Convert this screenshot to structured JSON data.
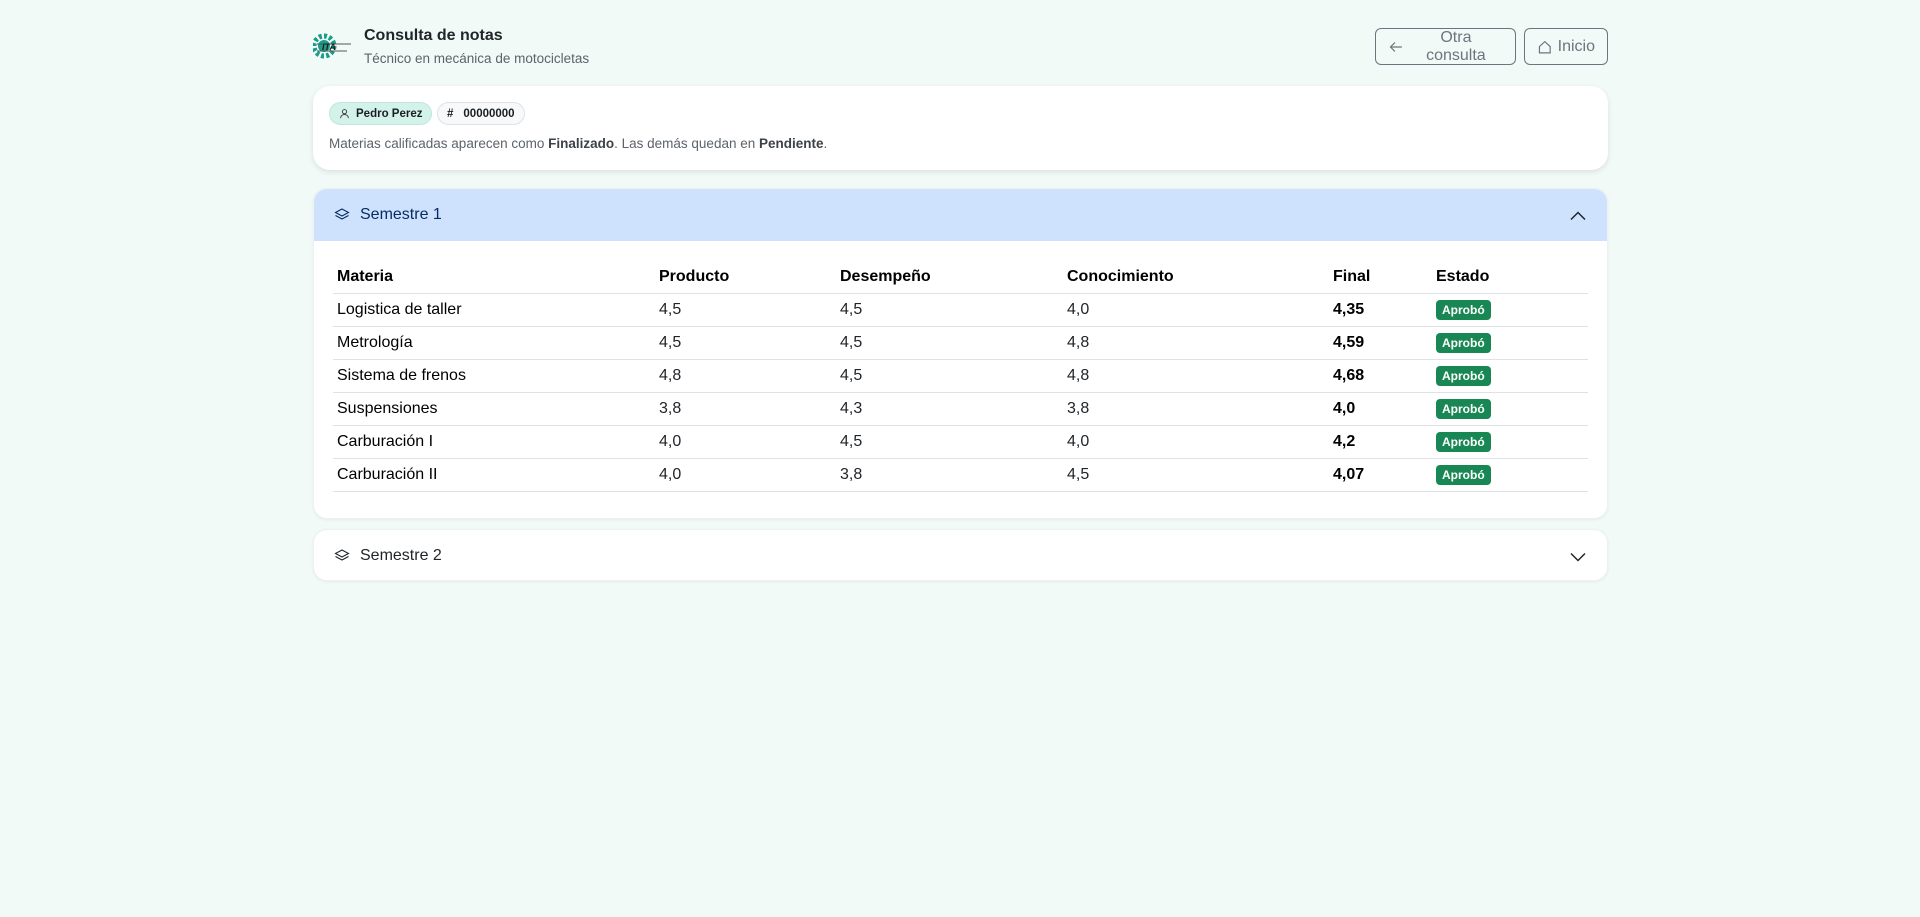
{
  "header": {
    "title": "Consulta de notas",
    "subtitle": "Técnico en mecánica de motocicletas",
    "logo_text": "ITA",
    "buttons": {
      "otra_consulta": "Otra consulta",
      "inicio": "Inicio"
    }
  },
  "student": {
    "name": "Pedro Perez",
    "id_symbol": "#",
    "id": "00000000",
    "note_prefix": "Materias calificadas aparecen como ",
    "note_finalizado": "Finalizado",
    "note_middle": ". Las demás quedan en ",
    "note_pendiente": "Pendiente",
    "note_suffix": "."
  },
  "semesters": [
    {
      "label": "Semestre 1",
      "expanded": true,
      "columns": [
        "Materia",
        "Producto",
        "Desempeño",
        "Conocimiento",
        "Final",
        "Estado"
      ],
      "rows": [
        {
          "materia": "Logistica de taller",
          "producto": "4,5",
          "desempeno": "4,5",
          "conocimiento": "4,0",
          "final": "4,35",
          "estado": "Aprobó"
        },
        {
          "materia": "Metrología",
          "producto": "4,5",
          "desempeno": "4,5",
          "conocimiento": "4,8",
          "final": "4,59",
          "estado": "Aprobó"
        },
        {
          "materia": "Sistema de frenos",
          "producto": "4,8",
          "desempeno": "4,5",
          "conocimiento": "4,8",
          "final": "4,68",
          "estado": "Aprobó"
        },
        {
          "materia": "Suspensiones",
          "producto": "3,8",
          "desempeno": "4,3",
          "conocimiento": "3,8",
          "final": "4,0",
          "estado": "Aprobó"
        },
        {
          "materia": "Carburación I",
          "producto": "4,0",
          "desempeno": "4,5",
          "conocimiento": "4,0",
          "final": "4,2",
          "estado": "Aprobó"
        },
        {
          "materia": "Carburación II",
          "producto": "4,0",
          "desempeno": "3,8",
          "conocimiento": "4,5",
          "final": "4,07",
          "estado": "Aprobó"
        }
      ]
    },
    {
      "label": "Semestre 2",
      "expanded": false
    }
  ],
  "colors": {
    "background": "#f1faf7",
    "accordion_active": "#cfe2fd",
    "badge_success": "#198754",
    "name_pill": "#d3f3ea",
    "logo_teal": "#1a9c8a"
  },
  "icons": {
    "back": "arrow-left-icon",
    "home": "house-icon",
    "person": "person-icon",
    "layers": "layers-icon",
    "collapse": "chevron-up-icon",
    "expand": "chevron-down-icon"
  }
}
